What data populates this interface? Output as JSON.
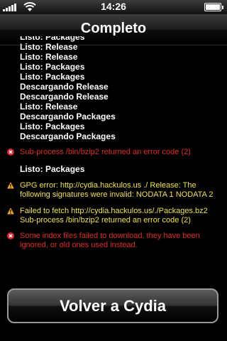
{
  "status_bar": {
    "time": "14:26",
    "battery_level": 1.0
  },
  "nav": {
    "title": "Completo"
  },
  "log": {
    "status_lines": [
      "Listo: Packages",
      "Listo: Release",
      "Listo: Release",
      "Listo: Packages",
      "Listo: Packages",
      "Descargando Release",
      "Descargando Release",
      "Listo: Release",
      "Descargando Packages",
      "Listo: Packages",
      "Descargando Packages"
    ],
    "error_1": "Sub-process /bin/bzip2 returned an error code (2)",
    "after_error_line": "Listo: Packages",
    "warning_1": "GPG error: http://cydia.hackulos.us ./ Release: The following signatures were invalid: NODATA 1 NODATA 2",
    "warning_2": "Failed to fetch http://cydia.hackulos.us/./Packages.bz2 Sub-process /bin/bzip2 returned an error code (2)",
    "error_2": "Some index files failed to download, they have been ignored, or old ones used instead."
  },
  "footer": {
    "back_button_label": "Volver a Cydia"
  },
  "colors": {
    "error": "#e12a2a",
    "warning": "#f0e24a",
    "text": "#ffffff",
    "background": "#000000"
  },
  "icons": {
    "error": "error-x-icon",
    "warning": "warning-triangle-icon"
  }
}
